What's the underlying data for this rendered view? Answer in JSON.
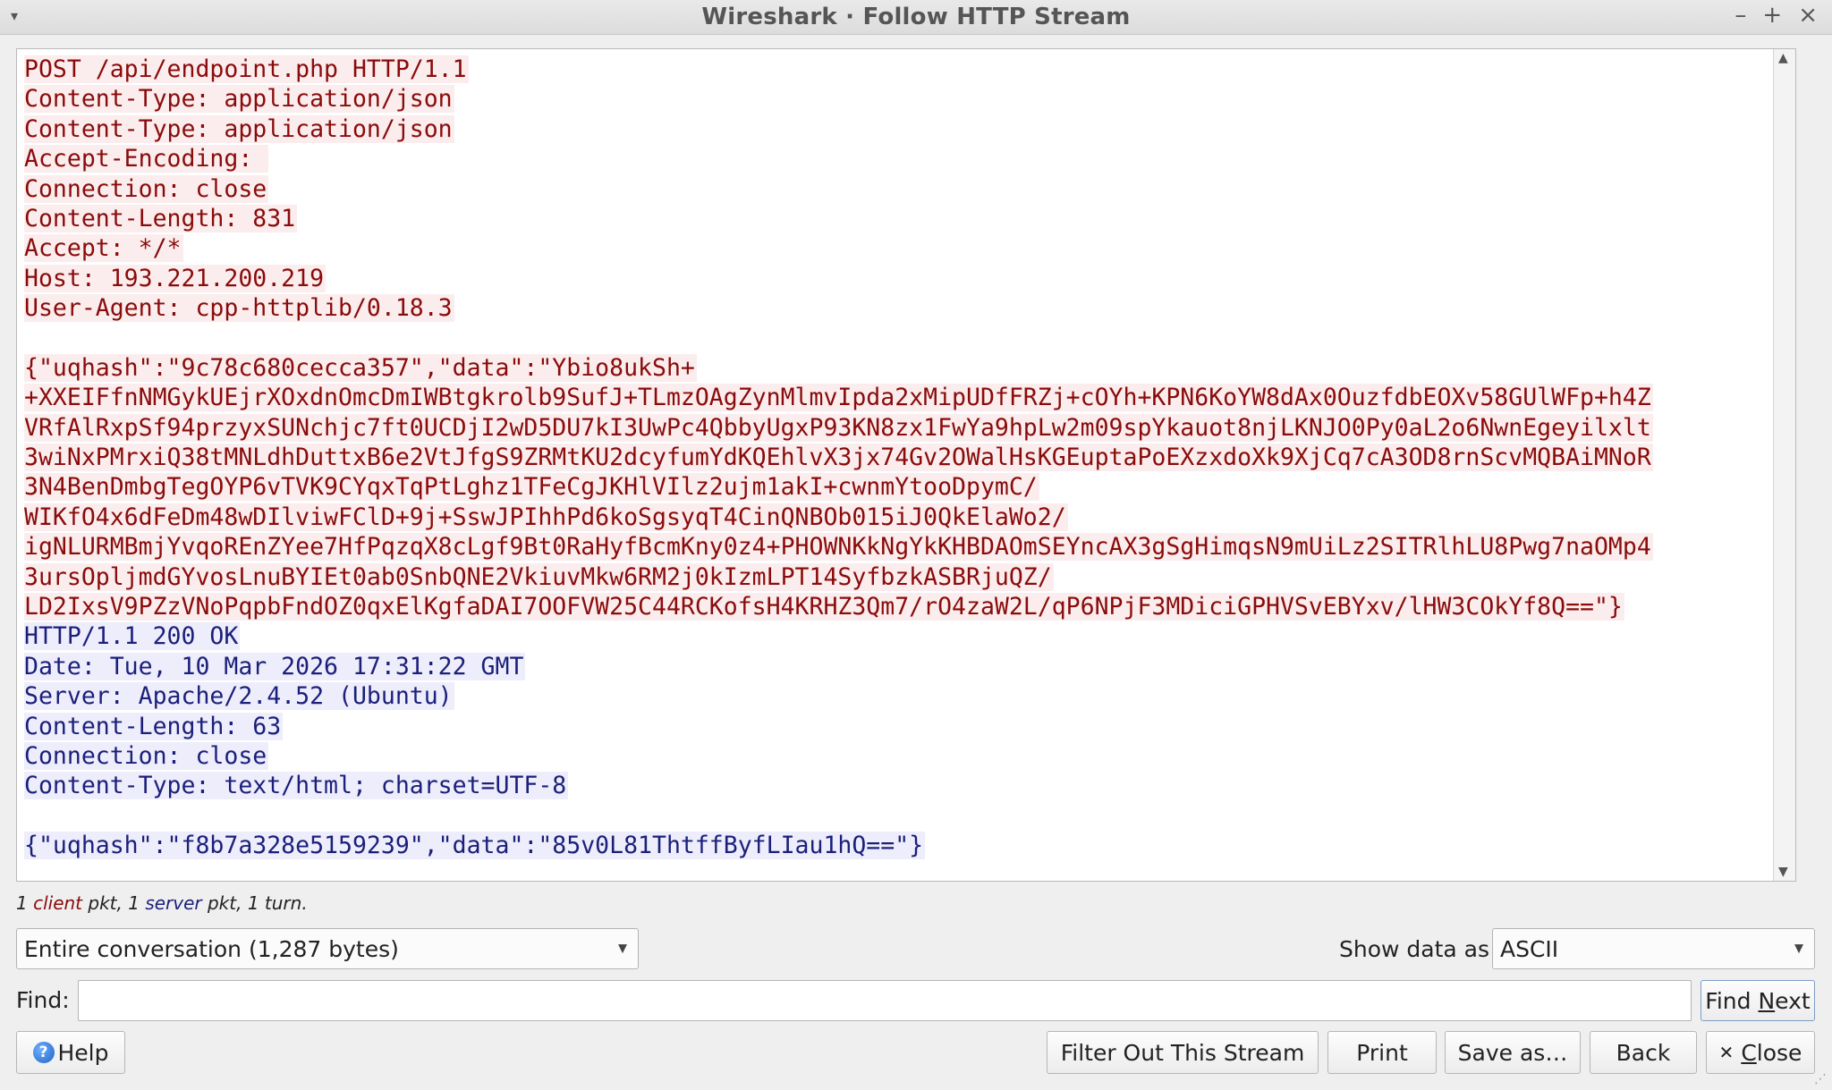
{
  "window": {
    "title": "Wireshark · Follow HTTP Stream",
    "menu_glyph": "▾",
    "minimize_glyph": "–",
    "maximize_glyph": "+",
    "close_glyph": "×"
  },
  "stream": {
    "client_lines": [
      "POST /api/endpoint.php HTTP/1.1",
      "Content-Type: application/json",
      "Content-Type: application/json",
      "Accept-Encoding: ",
      "Connection: close",
      "Content-Length: 831",
      "Accept: */*",
      "Host: 193.221.200.219",
      "User-Agent: cpp-httplib/0.18.3",
      "",
      "{\"uqhash\":\"9c78c680cecca357\",\"data\":\"Ybio8ukSh+",
      "+XXEIFfnNMGykUEjrXOxdnOmcDmIWBtgkrolb9SufJ+TLmzOAgZynMlmvIpda2xMipUDfFRZj+cOYh+KPN6KoYW8dAx0OuzfdbEOXv58GUlWFp+h4Z",
      "VRfAlRxpSf94przyxSUNchjc7ft0UCDjI2wD5DU7kI3UwPc4QbbyUgxP93KN8zx1FwYa9hpLw2m09spYkauot8njLKNJO0Py0aL2o6NwnEgeyilxlt",
      "3wiNxPMrxiQ38tMNLdhDuttxB6e2VtJfgS9ZRMtKU2dcyfumYdKQEhlvX3jx74Gv2OWalHsKGEuptaPoEXzxdoXk9XjCq7cA3OD8rnScvMQBAiMNoR",
      "3N4BenDmbgTegOYP6vTVK9CYqxTqPtLghz1TFeCgJKHlVIlz2ujm1akI+cwnmYtooDpymC/",
      "WIKfO4x6dFeDm48wDIlviwFClD+9j+SswJPIhhPd6koSgsyqT4CinQNBOb015iJ0QkElaWo2/",
      "igNLURMBmjYvqoREnZYee7HfPqzqX8cLgf9Bt0RaHyfBcmKny0z4+PHOWNKkNgYkKHBDAOmSEYncAX3gSgHimqsN9mUiLz2SITRlhLU8Pwg7naOMp4",
      "3ursOpljmdGYvosLnuBYIEt0ab0SnbQNE2VkiuvMkw6RM2j0kIzmLPT14SyfbzkASBRjuQZ/",
      "LD2IxsV9PZzVNoPqpbFndOZ0qxElKgfaDAI7OOFVW25C44RCKofsH4KRHZ3Qm7/rO4zaW2L/qP6NPjF3MDiciGPHVSvEBYxv/lHW3COkYf8Q==\"}"
    ],
    "server_lines": [
      "HTTP/1.1 200 OK",
      "Date: Tue, 10 Mar 2026 17:31:22 GMT",
      "Server: Apache/2.4.52 (Ubuntu)",
      "Content-Length: 63",
      "Connection: close",
      "Content-Type: text/html; charset=UTF-8",
      "",
      "{\"uqhash\":\"f8b7a328e5159239\",\"data\":\"85v0L81ThtffByfLIau1hQ==\"}"
    ],
    "colors": {
      "client_text": "#8a0b0b",
      "client_bg": "#fbeded",
      "server_text": "#1b1f7a",
      "server_bg": "#ededfb"
    }
  },
  "summary": {
    "count1": "1",
    "client_word": "client",
    "mid": "pkt, 1",
    "server_word": "server",
    "end": "pkt, 1 turn."
  },
  "controls": {
    "conversation_select": "Entire conversation (1,287 bytes)",
    "show_data_label": "Show data as",
    "show_data_select": "ASCII",
    "find_label": "Find:",
    "find_value": "",
    "find_next_pre": "Find ",
    "find_next_u": "N",
    "find_next_post": "ext"
  },
  "buttons": {
    "help": "Help",
    "filter_out": "Filter Out This Stream",
    "print": "Print",
    "save_as": "Save as…",
    "back": "Back",
    "close_u": "C",
    "close_rest": "lose"
  }
}
